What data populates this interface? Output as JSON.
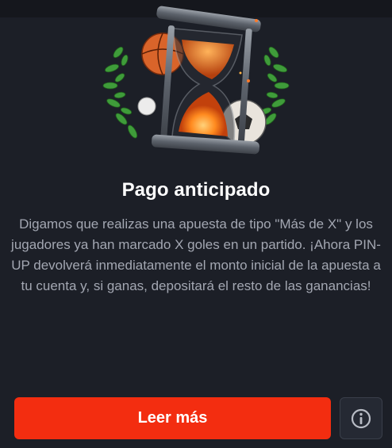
{
  "card": {
    "title": "Pago anticipado",
    "description": "Digamos que realizas una apuesta de tipo \"Más de X\" y los jugadores ya han marcado X goles en un partido. ¡Ahora PIN-UP devolverá inmediatamente el monto inicial de la apuesta a tu cuenta y, si ganas, depositará el resto de las ganancias!",
    "cta_label": "Leer más",
    "info_icon": "info-icon",
    "illustration_icon": "hourglass-icon"
  },
  "colors": {
    "background": "#1c1f27",
    "accent": "#f32d10",
    "text_primary": "#ffffff",
    "text_secondary": "#a3a7b2"
  }
}
